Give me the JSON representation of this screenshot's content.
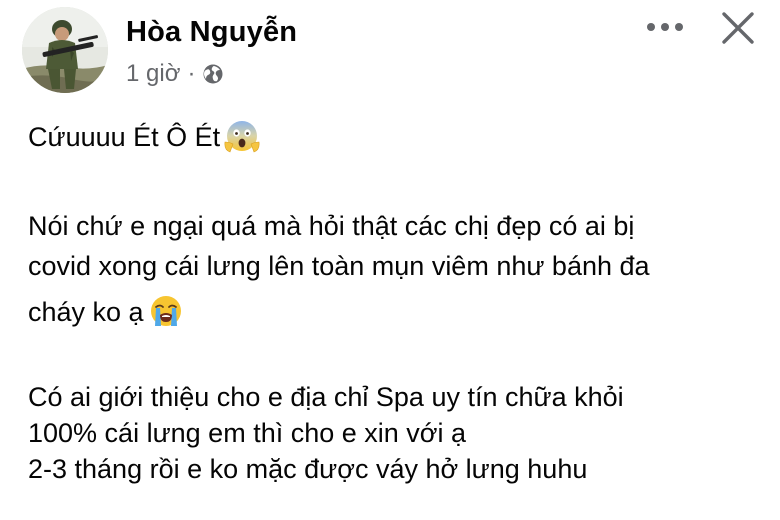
{
  "author": {
    "name": "Hòa Nguyễn",
    "avatar_icon": "avatar-soldier-photo"
  },
  "meta": {
    "time": "1 giờ",
    "separator": "·",
    "privacy_icon": "globe-icon"
  },
  "actions": {
    "more_icon": "more-options-icon",
    "close_icon": "close-icon"
  },
  "post": {
    "line_1": "Cứuuuu Ét Ô Ét",
    "line_1_emoji": "face-screaming-in-fear",
    "line_2": "Nói chứ e ngại quá mà hỏi thật các chị đẹp có ai bị",
    "line_3": "covid xong cái lưng lên toàn mụn viêm như bánh đa",
    "line_4": "cháy ko ạ",
    "line_4_emoji": "loudly-crying-face",
    "line_5": "Có ai giới thiệu cho e địa chỉ Spa uy tín chữa khỏi",
    "line_6": "100% cái lưng em thì cho e xin với ạ",
    "line_7": "2-3 tháng rồi e ko mặc được váy hở lưng huhu"
  },
  "colors": {
    "text_primary": "#050505",
    "text_secondary": "#65676b",
    "background": "#ffffff"
  }
}
